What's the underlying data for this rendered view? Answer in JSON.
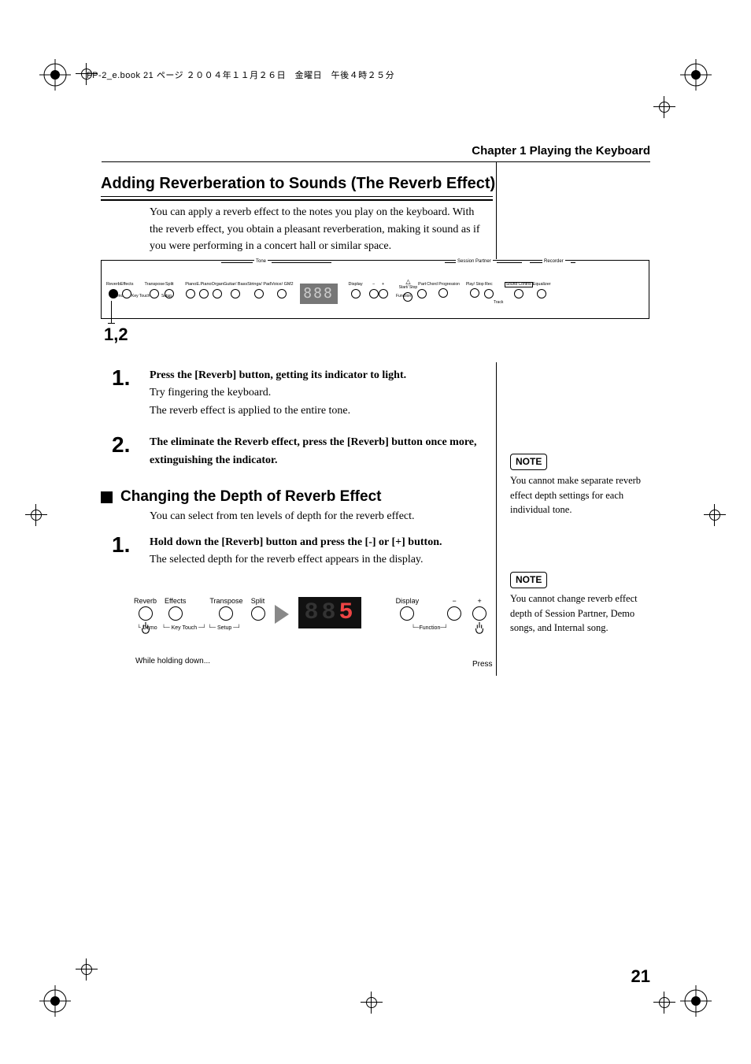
{
  "header_meta": "FP-2_e.book 21 ページ ２００４年１１月２６日　金曜日　午後４時２５分",
  "chapter": "Chapter 1 Playing the Keyboard",
  "section_title": "Adding Reverberation to Sounds (The Reverb Effect)",
  "intro": "You can apply a reverb effect to the notes you play on the keyboard. With the reverb effect, you obtain a pleasant reverberation, making it sound as if you were performing in a concert hall or similar space.",
  "panel": {
    "callout": "1,2",
    "group_tone": "Tone",
    "group_session": "Session Partner",
    "group_recorder": "Recorder",
    "buttons": [
      {
        "label": "Reverb"
      },
      {
        "label": "Effects"
      },
      {
        "label": "Transpose"
      },
      {
        "label": "Split"
      },
      {
        "label": "Piano"
      },
      {
        "label": "E.Piano"
      },
      {
        "label": "Organ"
      },
      {
        "label": "Guitar/\nBass"
      },
      {
        "label": "Strings/\nPad"
      },
      {
        "label": "Voice/\nGM2"
      },
      {
        "label": "Display"
      },
      {
        "label": "−"
      },
      {
        "label": "+"
      },
      {
        "label": "Start/\nStop",
        "tempo": true
      },
      {
        "label": "Part"
      },
      {
        "label": "Chord\nProgression"
      },
      {
        "label": "Play/\nStop"
      },
      {
        "label": "Rec"
      },
      {
        "label": "Sound\nControl",
        "boxed": true
      },
      {
        "label": "Equalizer"
      }
    ],
    "under": {
      "demo": "Demo",
      "keytouch": "Key Touch",
      "setup": "Setup",
      "function": "Function",
      "track": "Track"
    },
    "tempo_icon": "tempo-icon"
  },
  "steps": [
    {
      "num": "1.",
      "bold": "Press the [Reverb] button, getting its indicator to light.",
      "lines": [
        "Try fingering the keyboard.",
        "The reverb effect is applied to the entire tone."
      ]
    },
    {
      "num": "2.",
      "bold": "The eliminate the Reverb effect, press the [Reverb] button once more, extinguishing the indicator.",
      "lines": []
    }
  ],
  "sub_title": "Changing the Depth of Reverb Effect",
  "sub_intro": "You can select from ten levels of depth for the reverb effect.",
  "steps2": [
    {
      "num": "1.",
      "bold": "Hold down the [Reverb] button and press the [-] or [+] button.",
      "lines": [
        "The selected depth for the reverb effect appears in the display."
      ]
    }
  ],
  "illus2": {
    "left_buttons": [
      "Reverb",
      "Effects",
      "Transpose",
      "Split"
    ],
    "under_left": [
      "Demo",
      "Key Touch",
      "Setup"
    ],
    "seg_value": "5",
    "right_buttons": [
      "Display",
      "−",
      "+"
    ],
    "function_label": "Function",
    "hold_label": "While holding down...",
    "press_label": "Press"
  },
  "notes": [
    {
      "tag": "NOTE",
      "text": "You cannot make separate reverb effect depth settings for each individual tone."
    },
    {
      "tag": "NOTE",
      "text": "You cannot change reverb effect depth of Session Partner, Demo songs, and Internal song."
    }
  ],
  "page_number": "21"
}
